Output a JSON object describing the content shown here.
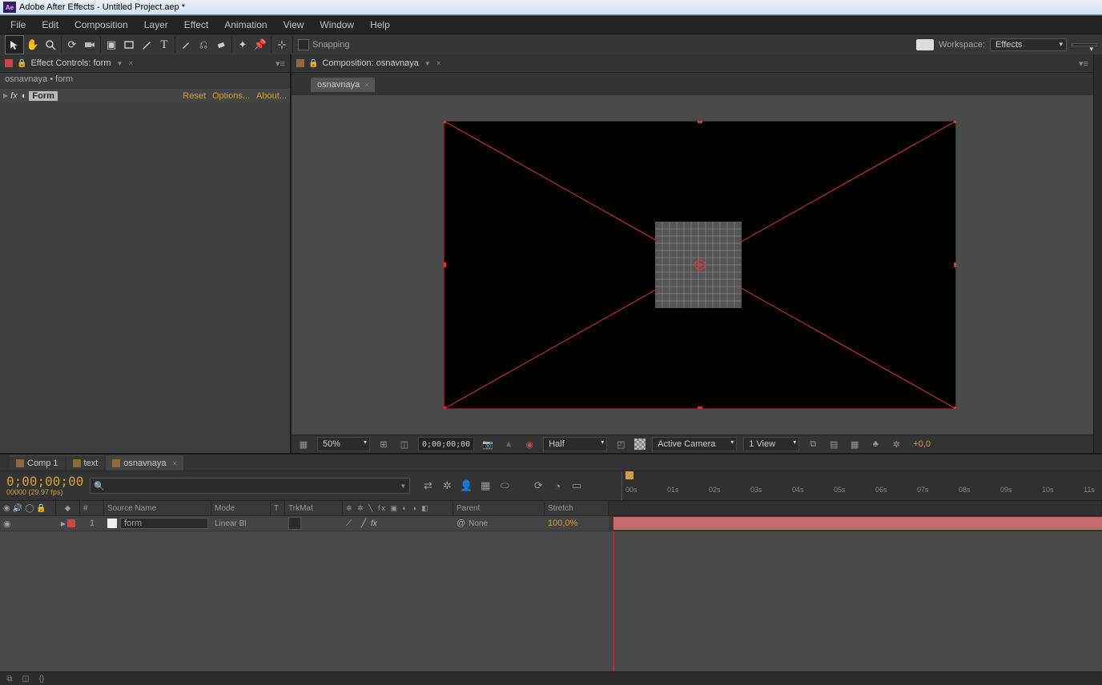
{
  "titlebar": {
    "app": "Adobe After Effects",
    "project": "Untitled Project.aep *"
  },
  "menu": [
    "File",
    "Edit",
    "Composition",
    "Layer",
    "Effect",
    "Animation",
    "View",
    "Window",
    "Help"
  ],
  "toolbar": {
    "snapping": "Snapping",
    "workspace_lbl": "Workspace:",
    "workspace": "Effects"
  },
  "effect_controls": {
    "panel_title": "Effect Controls: form",
    "sub": "osnavnaya • form",
    "fx_name": "Form",
    "links": {
      "reset": "Reset",
      "options": "Options...",
      "about": "About..."
    }
  },
  "composition": {
    "panel_title": "Composition: osnavnaya",
    "tab": "osnavnaya",
    "footer": {
      "zoom": "50%",
      "timecode": "0;00;00;00",
      "resolution": "Half",
      "camera": "Active Camera",
      "view": "1 View",
      "exposure": "+0,0"
    }
  },
  "timeline": {
    "tabs": [
      {
        "label": "Comp 1"
      },
      {
        "label": "text"
      },
      {
        "label": "osnavnaya",
        "active": true
      }
    ],
    "timecode": "0;00;00;00",
    "timecode_sub": "00000 (29.97 fps)",
    "search_placeholder": "",
    "ruler": [
      "00s",
      "01s",
      "02s",
      "03s",
      "04s",
      "05s",
      "06s",
      "07s",
      "08s",
      "09s",
      "10s",
      "11s"
    ],
    "columns": {
      "num": "#",
      "source": "Source Name",
      "mode": "Mode",
      "t": "T",
      "trkmat": "TrkMat",
      "parent": "Parent",
      "stretch": "Stretch"
    },
    "layer": {
      "index": "1",
      "name": "form",
      "mode": "Linear Bl",
      "parent": "None",
      "stretch": "100,0%"
    }
  }
}
